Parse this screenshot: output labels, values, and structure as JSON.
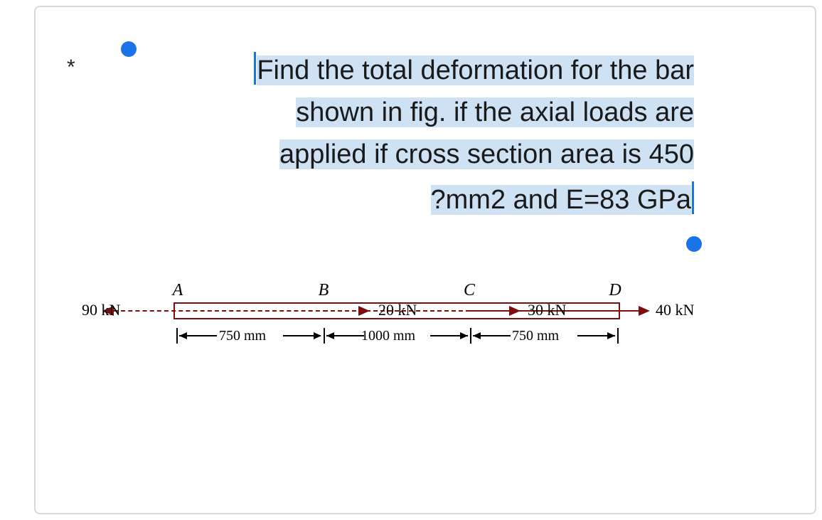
{
  "asterisk": "*",
  "question": {
    "line1": "Find the total deformation for the bar",
    "line2": "shown in fig. if the axial loads are",
    "line3": "applied if cross section area is 450",
    "line4_a": "?",
    "line4_b": "mm2 and E=83 GPa"
  },
  "diagram": {
    "points": {
      "A": "A",
      "B": "B",
      "C": "C",
      "D": "D"
    },
    "forces": {
      "left": "90 kN",
      "bc": "20 kN",
      "cd": "30 kN",
      "right": "40 kN"
    },
    "lengths": {
      "ab": "750 mm",
      "bc": "1000 mm",
      "cd": "750 mm"
    }
  }
}
